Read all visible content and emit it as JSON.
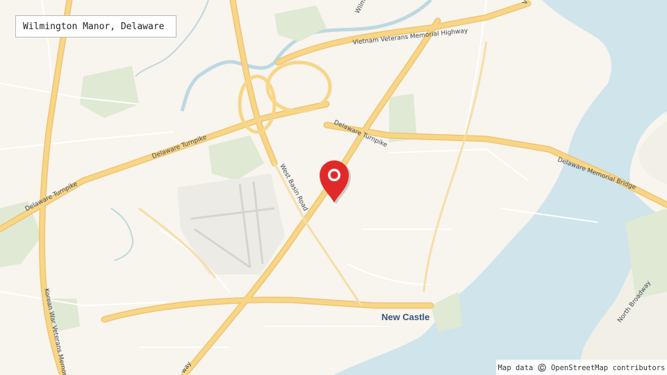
{
  "map": {
    "title": "Wilmington Manor, Delaware",
    "attribution": "Map data ©️ OpenStreetMap contributors",
    "marker_icon": "map-pin-icon",
    "marker_color": "#e02a2a",
    "colors": {
      "land": "#f8f4ee",
      "water": "#cfe4eb",
      "park": "#dfe9d4",
      "highway": "#f8d688",
      "highway_casing": "#efc46e"
    }
  },
  "places": {
    "city": "New Castle"
  },
  "roads": {
    "vietnam_veterans": "Vietnam Veterans Memorial Highway",
    "turnpike_center": "Delaware Turnpike",
    "turnpike_mid": "Delaware Turnpike",
    "turnpike_left": "Delaware Turnpike",
    "west_basin": "West Basin Road",
    "memorial_bridge": "Delaware Memorial Bridge",
    "korean_war": "Korean War Veterans Memorial",
    "north_broadway": "North Broadway",
    "wilmington_top": "Wilmi",
    "top_right_fragment": "V",
    "bottom_fragment": "way"
  }
}
